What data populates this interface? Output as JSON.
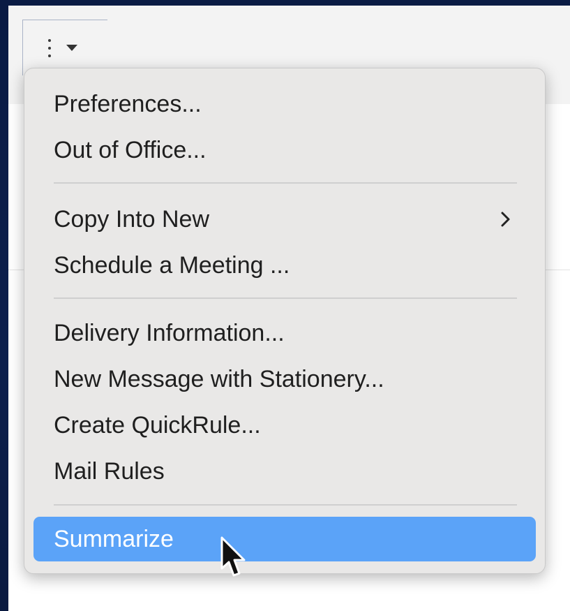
{
  "toolbar": {
    "more_button_icon": "more-vertical-icon",
    "dropdown_icon": "caret-down-icon"
  },
  "menu": {
    "items": [
      {
        "label": "Preferences..."
      },
      {
        "label": "Out of Office..."
      },
      {
        "label": "Copy Into New",
        "has_submenu": true
      },
      {
        "label": "Schedule a Meeting ..."
      },
      {
        "label": "Delivery Information..."
      },
      {
        "label": "New Message with Stationery..."
      },
      {
        "label": "Create QuickRule..."
      },
      {
        "label": "Mail Rules"
      },
      {
        "label": "Summarize",
        "selected": true
      }
    ],
    "selected_color": "#5ba3f8"
  }
}
